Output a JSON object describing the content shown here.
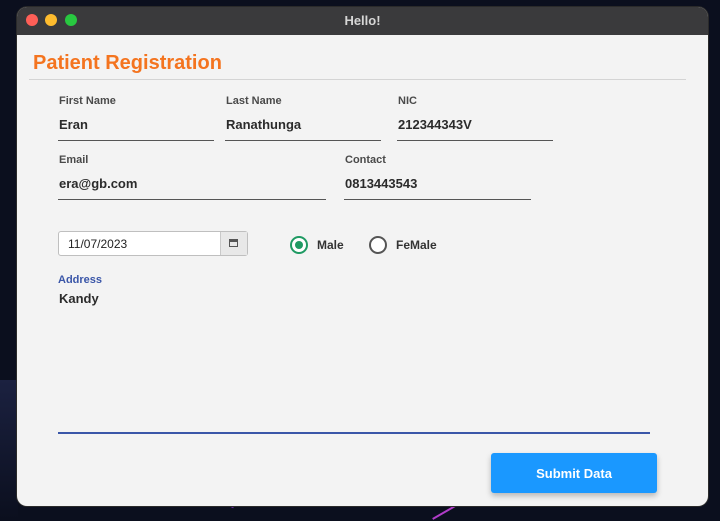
{
  "window": {
    "title": "Hello!"
  },
  "form": {
    "heading": "Patient Registration",
    "first_name": {
      "label": "First Name",
      "value": "Eran"
    },
    "last_name": {
      "label": "Last Name",
      "value": "Ranathunga"
    },
    "nic": {
      "label": "NIC",
      "value": "212344343V"
    },
    "email": {
      "label": "Email",
      "value": "era@gb.com"
    },
    "contact": {
      "label": "Contact",
      "value": "0813443543"
    },
    "dob": {
      "value": "11/07/2023"
    },
    "gender": {
      "options": [
        {
          "label": "Male",
          "selected": true
        },
        {
          "label": "FeMale",
          "selected": false
        }
      ]
    },
    "address": {
      "label": "Address",
      "value": "Kandy"
    },
    "submit_label": "Submit Data"
  },
  "colors": {
    "heading": "#f4741f",
    "accent_blue": "#1a98ff",
    "radio_selected": "#1f9a63",
    "address_line": "#3a56a8"
  }
}
